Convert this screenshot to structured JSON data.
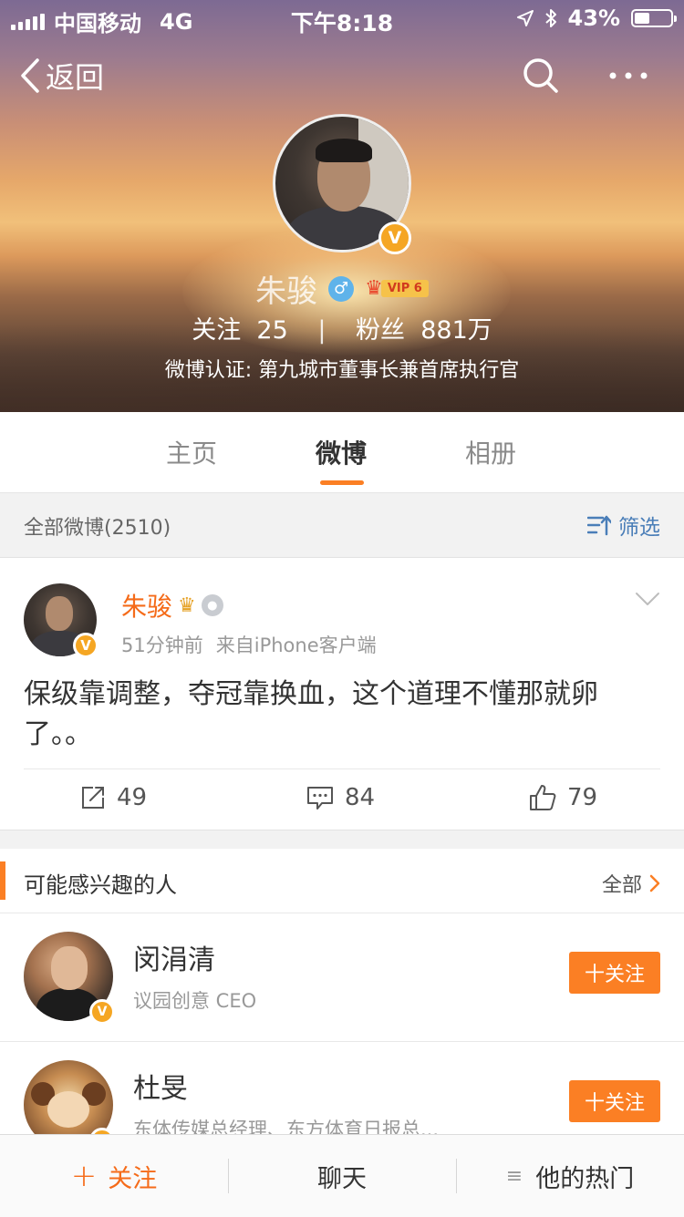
{
  "status_bar": {
    "carrier": "中国移动",
    "network": "4G",
    "time": "下午8:18",
    "battery": "43%",
    "battery_fraction": 0.43
  },
  "nav": {
    "back_label": "返回"
  },
  "profile": {
    "name": "朱骏",
    "gender_icon": "male-icon",
    "vip_label": "VIP 6",
    "following_label": "关注",
    "following_count": "25",
    "followers_label": "粉丝",
    "followers_count": "881万",
    "separator": "|",
    "certification": "微博认证: 第九城市董事长兼首席执行官",
    "verified_mark": "V"
  },
  "tabs": [
    {
      "label": "主页"
    },
    {
      "label": "微博"
    },
    {
      "label": "相册"
    }
  ],
  "filter_bar": {
    "label": "全部微博(2510)",
    "filter_label": "筛选"
  },
  "post": {
    "author": "朱骏",
    "time": "51分钟前",
    "source": "来自iPhone客户端",
    "content": "保级靠调整，夺冠靠换血，这个道理不懂那就卵了。。",
    "reposts": "49",
    "comments": "84",
    "likes": "79"
  },
  "suggestions": {
    "title": "可能感兴趣的人",
    "all_label": "全部",
    "people": [
      {
        "name": "闵涓清",
        "desc": "议园创意 CEO",
        "follow_label": "十关注"
      },
      {
        "name": "杜旻",
        "desc": "东体传媒总经理、东方体育日报总...",
        "follow_label": "十关注"
      }
    ]
  },
  "bottom_bar": {
    "follow": "关注",
    "chat": "聊天",
    "hot": "他的热门"
  },
  "colors": {
    "accent": "#fb7f24",
    "link_blue": "#4a7eb8",
    "verified": "#f5a623"
  }
}
